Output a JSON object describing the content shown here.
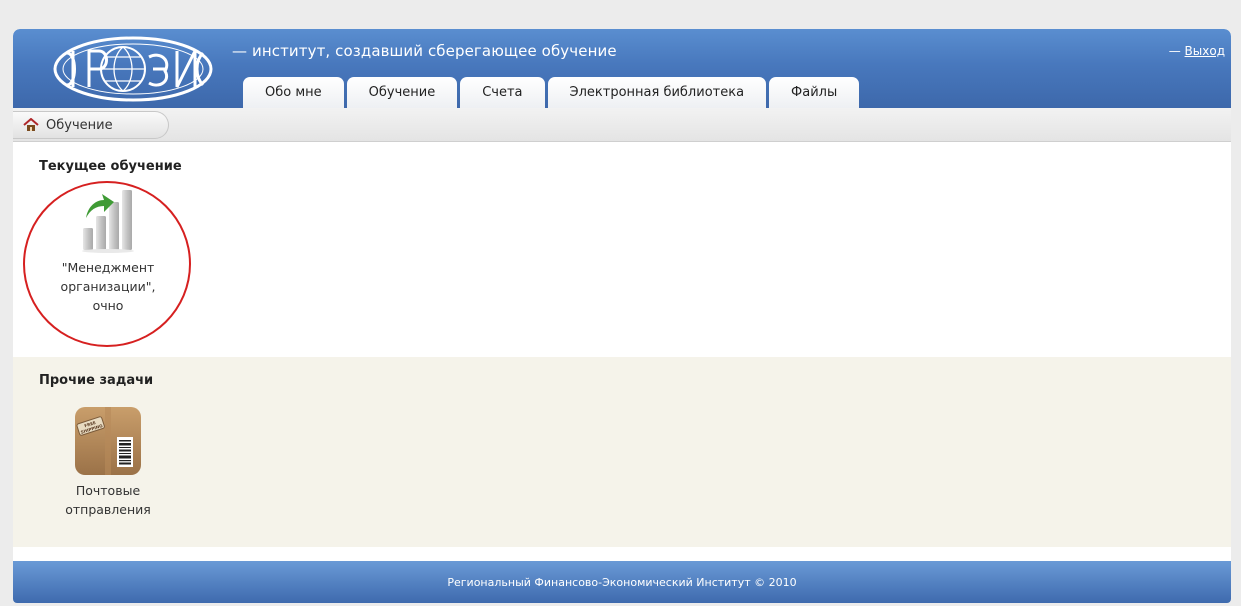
{
  "header": {
    "tagline": "— институт, создавший сберегающее обучение",
    "logout_dash": "— ",
    "logout_label": "Выход"
  },
  "tabs": [
    {
      "label": "Обо мне"
    },
    {
      "label": "Обучение"
    },
    {
      "label": "Счета"
    },
    {
      "label": "Электронная библиотека"
    },
    {
      "label": "Файлы"
    }
  ],
  "breadcrumb": {
    "label": "Обучение"
  },
  "sections": {
    "current": {
      "title": "Текущее обучение",
      "items": [
        {
          "label_lines": [
            "\"Менеджмент",
            "организации\",",
            "очно"
          ],
          "icon": "growth-chart-icon"
        }
      ]
    },
    "other": {
      "title": "Прочие задачи",
      "items": [
        {
          "label_lines": [
            "Почтовые",
            "отправления"
          ],
          "icon": "parcel-box-icon",
          "stamp_text": "FREE SHIPPING"
        }
      ]
    }
  },
  "footer": {
    "text": "Региональный Финансово-Экономический Институт © 2010"
  },
  "colors": {
    "header_blue": "#4878bd",
    "highlight_red": "#d62020",
    "arrow_green": "#3f9b35",
    "other_bg": "#f5f3ea"
  }
}
